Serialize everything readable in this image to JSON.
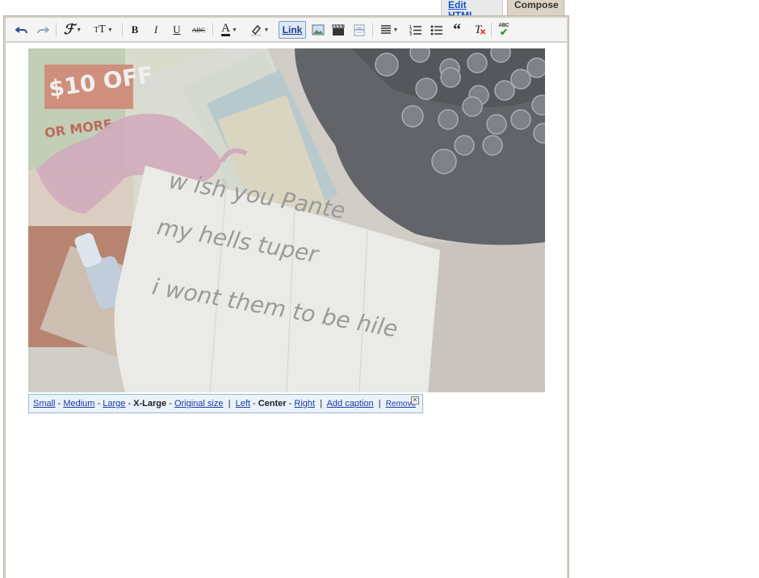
{
  "tabs": {
    "edit_html": "Edit HTML",
    "compose": "Compose"
  },
  "toolbar": {
    "link_label": "Link",
    "strikethrough_label": "ABC",
    "spellcheck_label": "ABC"
  },
  "image": {
    "note_lines": [
      "w ish you Pante",
      "my hells tuper",
      "i wont them to be hile"
    ]
  },
  "image_options": {
    "size_small": "Small",
    "size_medium": "Medium",
    "size_large": "Large",
    "size_xlarge": "X-Large",
    "size_original": "Original size",
    "align_left": "Left",
    "align_center": "Center",
    "align_right": "Right",
    "add_caption": "Add caption",
    "remove": "Remove",
    "dash": "-",
    "pipe": "|"
  },
  "colors": {
    "accent": "#1155cc",
    "compose_tab": "#ddd3c4",
    "imagebar_bg": "#eaf2fb"
  }
}
